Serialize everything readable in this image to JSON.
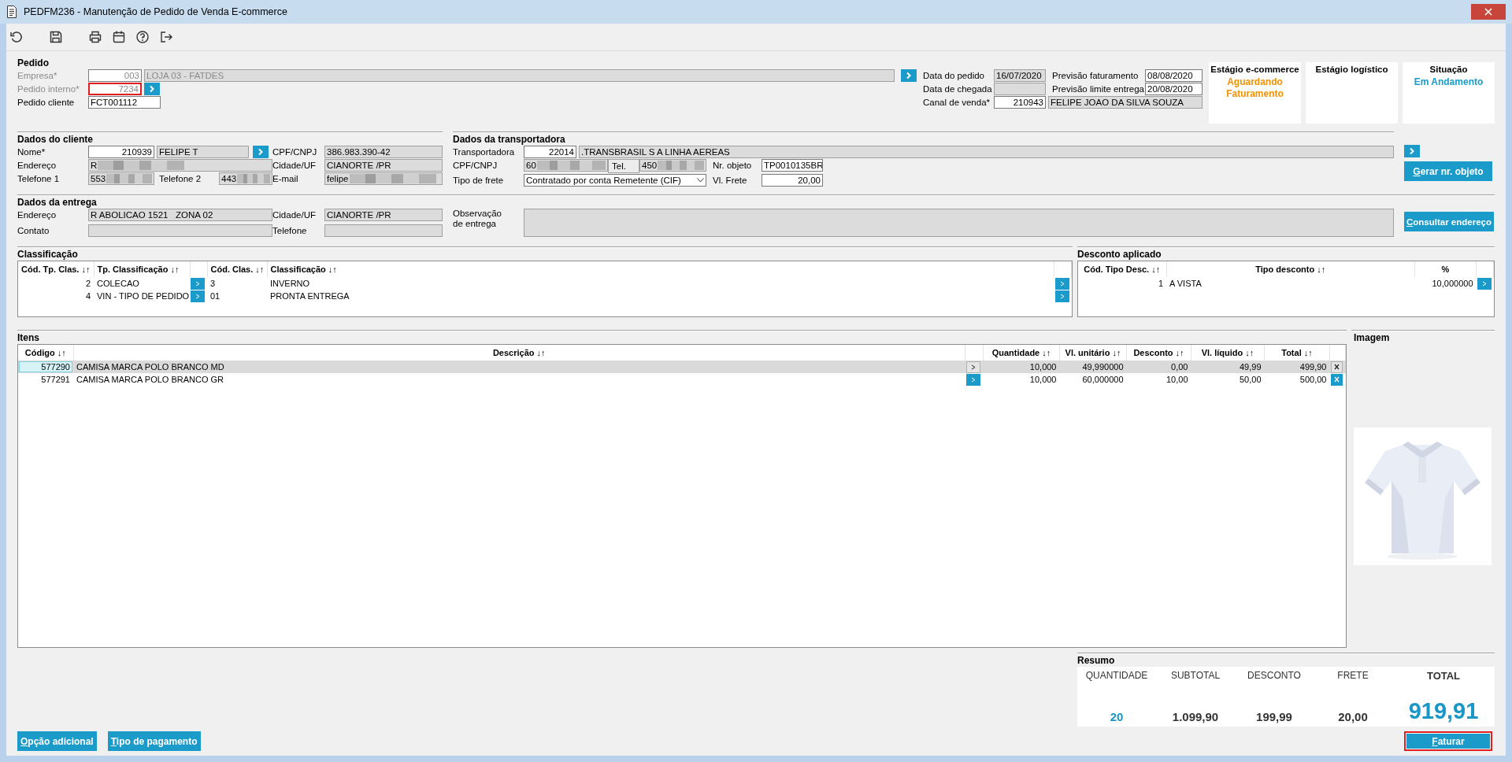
{
  "window": {
    "title": "PEDFM236 - Manutenção de Pedido de Venda E-commerce"
  },
  "pedido": {
    "heading": "Pedido",
    "empresa": {
      "label": "Empresa*",
      "disabled": true,
      "input": {
        "value": "003",
        "readonly": false
      },
      "name_input": {
        "value": "LOJA 03 - FATDES",
        "readonly": true
      }
    },
    "pedido_interno": {
      "label": "Pedido interno*",
      "disabled": true,
      "input": {
        "value": "7234",
        "readonly": false,
        "highlighted": true
      }
    },
    "pedido_cliente": {
      "label": "Pedido cliente",
      "disabled": false,
      "input": {
        "value": "FCT001112",
        "readonly": false
      }
    },
    "data_do_pedido": {
      "label": "Data do pedido",
      "input": {
        "value": "16/07/2020",
        "readonly": true
      }
    },
    "previsao_faturamento": {
      "label": "Previsão faturamento",
      "input": {
        "value": "08/08/2020",
        "readonly": false
      }
    },
    "data_de_chegada": {
      "label": "Data de chegada",
      "input": {
        "readonly": true
      }
    },
    "previsao_limite_entrega": {
      "label": "Previsão limite entrega",
      "input": {
        "value": "20/08/2020",
        "readonly": false
      }
    },
    "canal_de_venda": {
      "label": "Canal de venda*",
      "input": {
        "value": "210943",
        "readonly": false
      },
      "name_input": {
        "value": "FELIPE JOAO DA SILVA SOUZA",
        "readonly": true
      }
    }
  },
  "stages": [
    {
      "label": "Estágio e-commerce",
      "value": "Aguardando Faturamento",
      "color": "#f39200"
    },
    {
      "label": "Estágio logístico"
    },
    {
      "label": "Situação",
      "value": "Em Andamento",
      "color": "#1a9bc9"
    }
  ],
  "cliente": {
    "heading": "Dados do cliente",
    "nome": {
      "label": "Nome*",
      "input": {
        "value": "210939",
        "readonly": false
      },
      "name_input": {
        "value": "FELIPE T",
        "readonly": true
      }
    },
    "cpf_cnpj": {
      "label": "CPF/CNPJ",
      "input": {
        "value": "386.983.390-42",
        "readonly": true
      }
    },
    "endereco": {
      "label": "Endereço",
      "input": {
        "value": "R",
        "readonly": true,
        "redacted": true
      }
    },
    "cidade_uf": {
      "label": "Cidade/UF",
      "input": {
        "value": "CIANORTE /PR",
        "readonly": true
      }
    },
    "telefone_1": {
      "label": "Telefone 1",
      "input": {
        "value": "553",
        "readonly": true,
        "redacted": true
      }
    },
    "telefone_2": {
      "label": "Telefone 2",
      "input": {
        "value": "443",
        "readonly": true,
        "redacted": true
      }
    },
    "email": {
      "label": "E-mail",
      "input": {
        "value": "felipe",
        "readonly": true,
        "redacted": true
      }
    }
  },
  "transportadora": {
    "heading": "Dados da transportadora",
    "transportadora": {
      "label": "Transportadora",
      "input": {
        "value": "22014",
        "readonly": false
      },
      "name_input": {
        "value": ".TRANSBRASIL S A LINHA AEREAS",
        "readonly": true
      }
    },
    "cpf_cnpj": {
      "label": "CPF/CNPJ",
      "input": {
        "value": "60",
        "readonly": true,
        "redacted": true
      }
    },
    "tel": {
      "label": "Tel.",
      "input": {
        "value": "450",
        "readonly": true,
        "redacted": true
      }
    },
    "nr_objeto": {
      "label": "Nr. objeto",
      "input": {
        "value": "TP0010135BR",
        "readonly": false
      }
    },
    "tipo_de_frete": {
      "label": "Tipo de frete",
      "input": {
        "value": "Contratado por conta Remetente (CIF)",
        "readonly": false,
        "kind": "select"
      }
    },
    "vl_frete": {
      "label": "Vl. Frete",
      "input": {
        "value": "20,00",
        "readonly": false
      }
    },
    "gerar_button": "Gerar nr. objeto"
  },
  "entrega": {
    "heading": "Dados da entrega",
    "endereco": {
      "label": "Endereço",
      "input": {
        "value": "R ABOLICAO 1521   ZONA 02",
        "readonly": true
      }
    },
    "cidade_uf": {
      "label": "Cidade/UF",
      "input": {
        "value": "CIANORTE /PR",
        "readonly": true
      }
    },
    "observacao": {
      "label": "Observação de entrega",
      "input": {
        "readonly": true
      }
    },
    "contato": {
      "label": "Contato",
      "input": {
        "readonly": true
      }
    },
    "telefone": {
      "label": "Telefone",
      "input": {
        "readonly": true
      }
    },
    "consultar_button": "Consultar endereço"
  },
  "classificacao": {
    "heading": "Classificação",
    "columns": [
      "Cód. Tp. Clas. ↓↑",
      "Tp. Classificação ↓↑",
      "Cód. Clas. ↓↑",
      "Classificação ↓↑"
    ],
    "rows": [
      {
        "cod_tp": "2",
        "tp": "COLECAO",
        "cod": "3",
        "classificacao": "INVERNO"
      },
      {
        "cod_tp": "4",
        "tp": "VIN - TIPO DE PEDIDO",
        "cod": "01",
        "classificacao": "PRONTA ENTREGA"
      }
    ]
  },
  "desconto": {
    "heading": "Desconto aplicado",
    "columns": [
      "Cód. Tipo Desc. ↓↑",
      "Tipo desconto ↓↑",
      "%"
    ],
    "rows": [
      {
        "cod": "1",
        "tipo": "A VISTA",
        "percent": "10,000000"
      }
    ]
  },
  "itens": {
    "heading": "Itens",
    "columns": [
      "Código ↓↑",
      "Descrição ↓↑",
      "Quantidade ↓↑",
      "Vl. unitário ↓↑",
      "Desconto ↓↑",
      "Vl. líquido ↓↑",
      "Total ↓↑"
    ],
    "rows": [
      {
        "codigo": "577290",
        "descricao": "CAMISA MARCA POLO BRANCO MD",
        "quantidade": "10,000",
        "vl_unitario": "49,990000",
        "desconto": "0,00",
        "vl_liquido": "49,99",
        "total": "499,90",
        "selected": true
      },
      {
        "codigo": "577291",
        "descricao": "CAMISA MARCA POLO BRANCO GR",
        "quantidade": "10,000",
        "vl_unitario": "60,000000",
        "desconto": "10,00",
        "vl_liquido": "50,00",
        "total": "500,00",
        "selected": false
      }
    ]
  },
  "imagem": {
    "heading": "Imagem",
    "kind": "picture"
  },
  "resumo": {
    "heading": "Resumo",
    "items": [
      {
        "label": "QUANTIDADE",
        "value": "20",
        "kind": "quantity"
      },
      {
        "label": "SUBTOTAL",
        "value": "1.099,90",
        "kind": "amount"
      },
      {
        "label": "DESCONTO",
        "value": "199,99",
        "kind": "amount"
      },
      {
        "label": "FRETE",
        "value": "20,00",
        "kind": "amount"
      },
      {
        "label": "TOTAL",
        "value": "919,91",
        "kind": "total"
      }
    ]
  },
  "buttons": [
    {
      "label": "Opção adicional",
      "highlighted": false
    },
    {
      "label": "Tipo de pagamento",
      "highlighted": false
    },
    {
      "label": "Faturar",
      "highlighted": true
    }
  ]
}
